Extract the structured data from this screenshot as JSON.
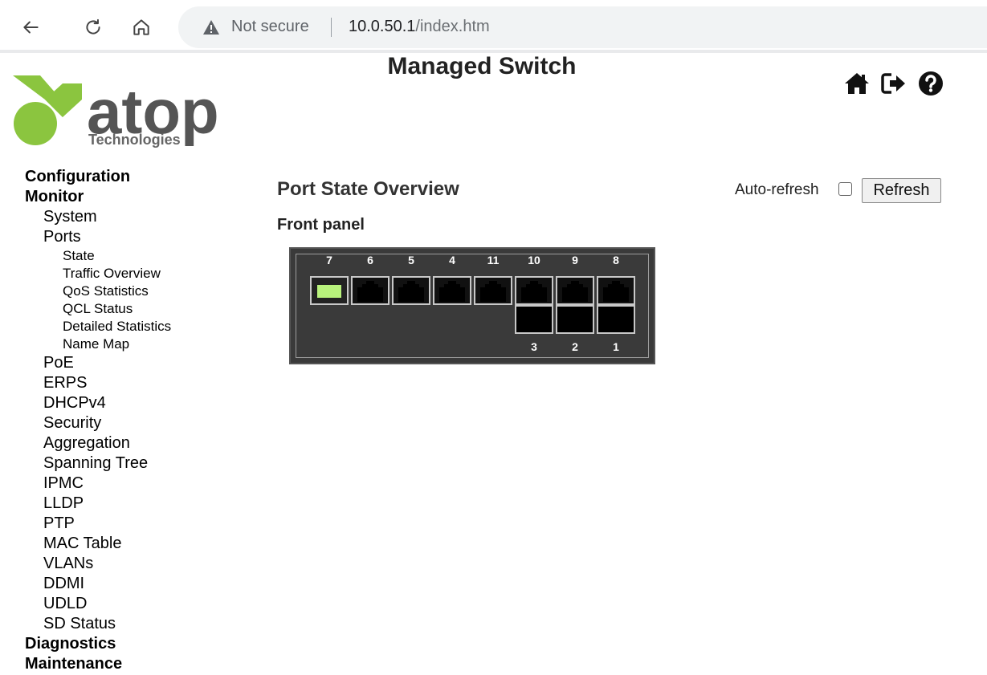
{
  "browser": {
    "security_label": "Not secure",
    "url_host": "10.0.50.1",
    "url_path": "/index.htm"
  },
  "header": {
    "app_title": "Managed Switch",
    "logo_word": "atop",
    "logo_subtitle": "Technologies",
    "icons": [
      "home-icon",
      "logout-icon",
      "help-icon"
    ]
  },
  "sidebar": {
    "configuration": "Configuration",
    "monitor": "Monitor",
    "system": "System",
    "ports": "Ports",
    "ports_children": [
      "State",
      "Traffic Overview",
      "QoS Statistics",
      "QCL Status",
      "Detailed Statistics",
      "Name Map"
    ],
    "monitor_children": [
      "PoE",
      "ERPS",
      "DHCPv4",
      "Security",
      "Aggregation",
      "Spanning Tree",
      "IPMC",
      "LLDP",
      "PTP",
      "MAC Table",
      "VLANs",
      "DDMI",
      "UDLD",
      "SD Status"
    ],
    "diagnostics": "Diagnostics",
    "maintenance": "Maintenance"
  },
  "main": {
    "title": "Port State Overview",
    "auto_refresh_label": "Auto-refresh",
    "auto_refresh_checked": false,
    "refresh_button": "Refresh",
    "section_label": "Front panel"
  },
  "front_panel": {
    "top_labels": [
      "7",
      "6",
      "5",
      "4",
      "11",
      "10",
      "9",
      "8"
    ],
    "bottom_labels": [
      "3",
      "2",
      "1"
    ],
    "link_up_color": "#b8f27c",
    "port_states": {
      "7": "link-up",
      "6": "down",
      "5": "down",
      "4": "down",
      "11": "down",
      "10": "down",
      "9": "down",
      "8": "down",
      "3": "down",
      "2": "down",
      "1": "down"
    }
  }
}
